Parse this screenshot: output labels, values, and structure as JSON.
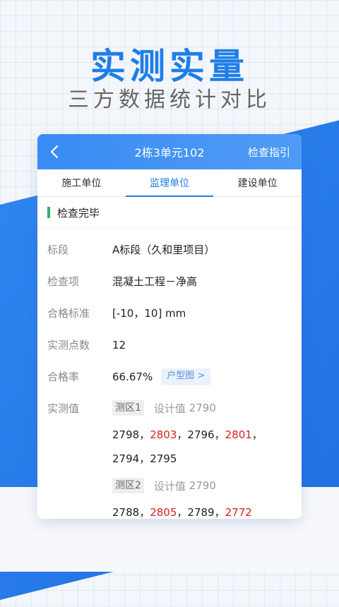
{
  "hero": {
    "title": "实测实量",
    "subtitle": "三方数据统计对比"
  },
  "header": {
    "title": "2栋3单元102",
    "guide_label": "检查指引",
    "back_icon": "chevron-left-icon"
  },
  "tabs": [
    {
      "label": "施工单位",
      "active": false
    },
    {
      "label": "监理单位",
      "active": true
    },
    {
      "label": "建设单位",
      "active": false
    }
  ],
  "status": {
    "label": "检查完毕",
    "color": "#2cb36a"
  },
  "details": {
    "section_label": "标段",
    "section_value": "A标段（久和里项目）",
    "item_label": "检查项",
    "item_value": "混凝土工程－净高",
    "standard_label": "合格标准",
    "standard_value": "[-10，10] mm",
    "points_label": "实测点数",
    "points_value": "12",
    "rate_label": "合格率",
    "rate_value": "66.67%",
    "floorplan_link": "户型图 >",
    "measured_label": "实测值"
  },
  "zones": [
    {
      "name": "测区1",
      "design_label": "设计值",
      "design_value": "2790",
      "values": [
        "2798",
        "2803",
        "2796",
        "2801",
        "2794",
        "2795"
      ],
      "flagged": [
        false,
        true,
        false,
        true,
        false,
        false
      ]
    },
    {
      "name": "测区2",
      "design_label": "设计值",
      "design_value": "2790",
      "values": [
        "2788",
        "2805",
        "2789",
        "2772"
      ],
      "flagged": [
        false,
        true,
        false,
        true
      ]
    }
  ],
  "colors": {
    "accent": "#1e7ee8",
    "flag": "#d82020"
  }
}
